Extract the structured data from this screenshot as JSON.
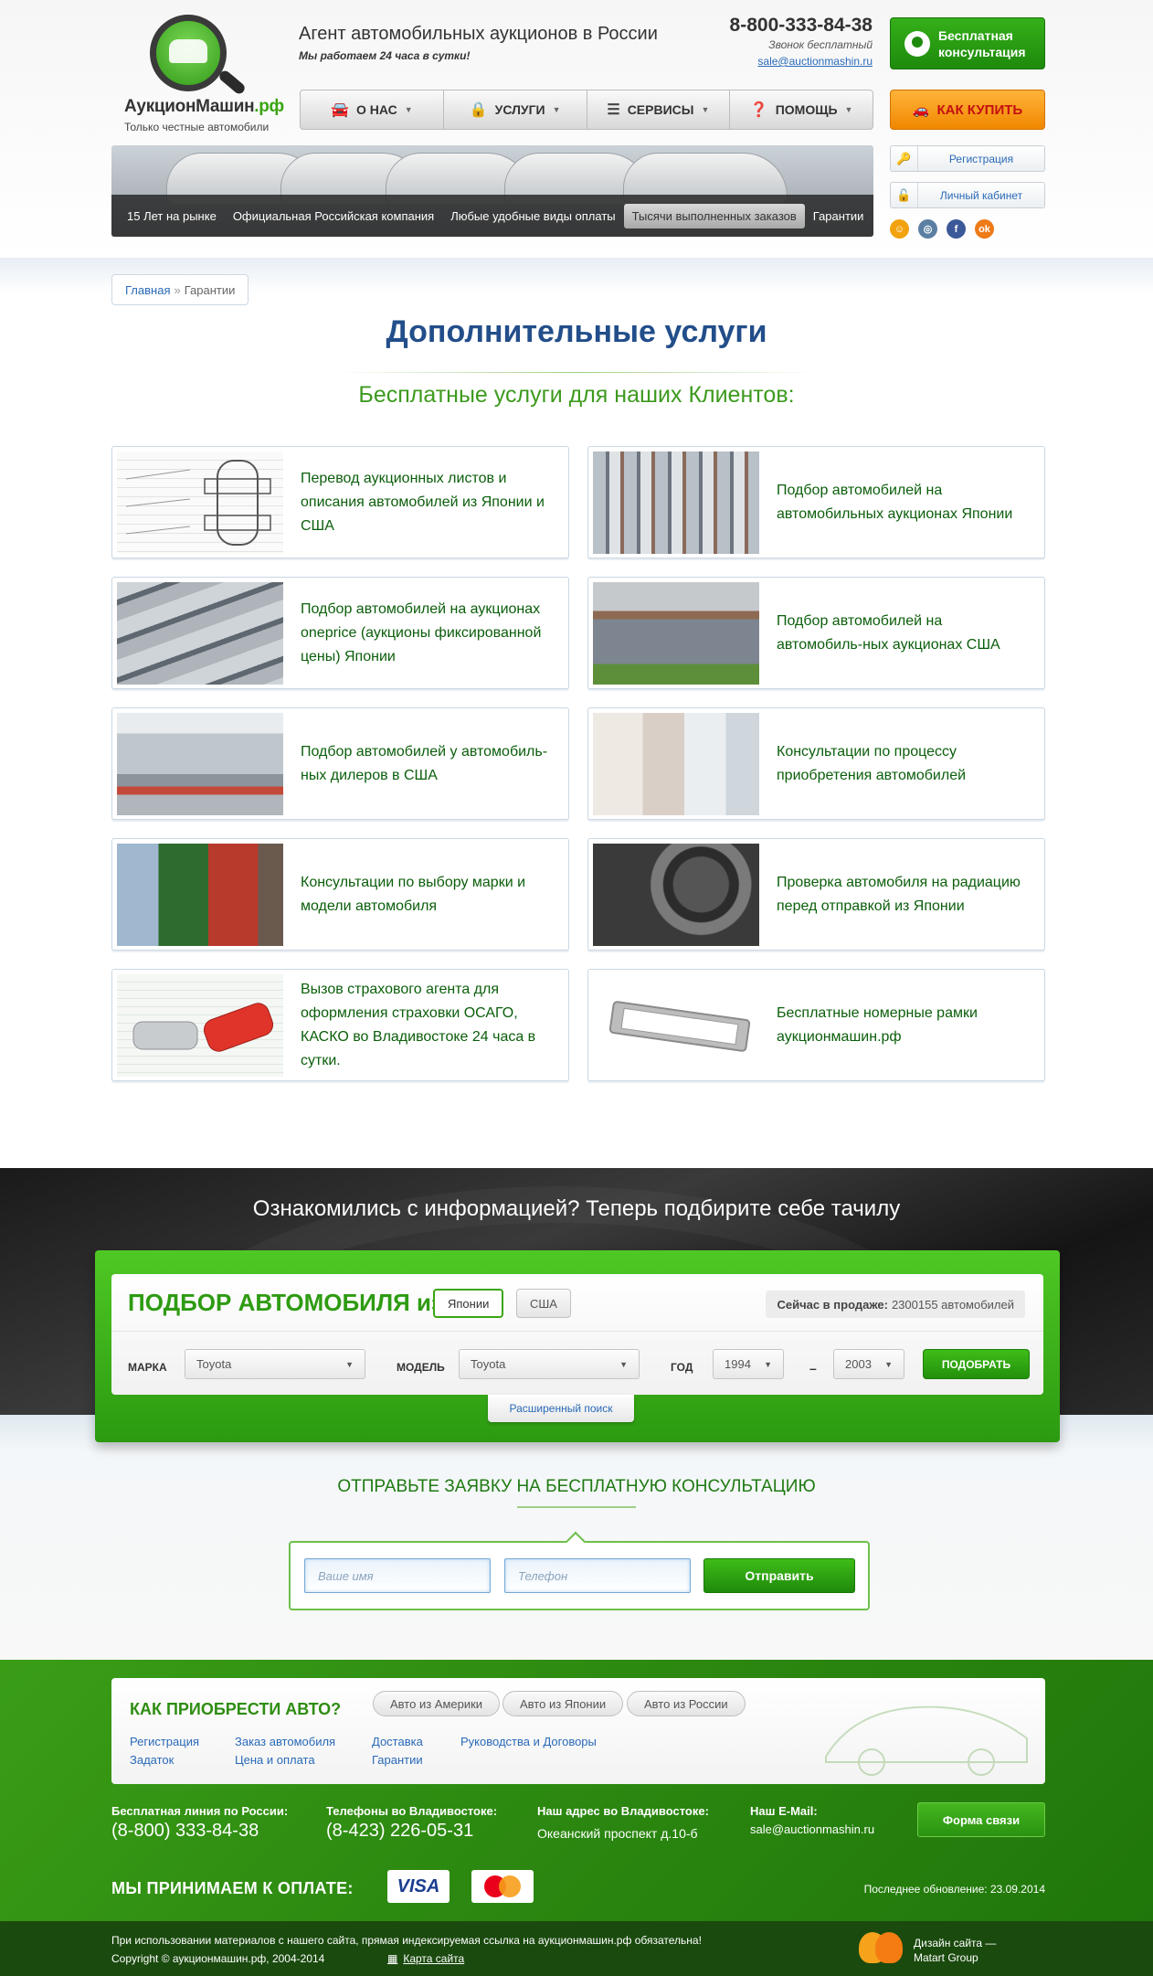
{
  "header": {
    "logo_name": "АукционМашин",
    "logo_rf": ".рф",
    "logo_tagline": "Только честные автомобили",
    "slogan": "Агент автомобильных аукционов в России",
    "slogan_sub": "Мы работаем 24 часа в сутки!",
    "phone": "8-800-333-84-38",
    "phone_note": "Звонок бесплатный",
    "email": "sale@auctionmashin.ru",
    "consult_button": "Бесплатная консультация",
    "howbuy_button": "КАК КУПИТЬ",
    "nav": [
      {
        "label": "О НАС",
        "icon": "car-icon"
      },
      {
        "label": "УСЛУГИ",
        "icon": "lock-icon"
      },
      {
        "label": "СЕРВИСЫ",
        "icon": "list-icon"
      },
      {
        "label": "ПОМОЩЬ",
        "icon": "help-icon"
      }
    ],
    "banner_tabs": [
      "15 Лет на рынке",
      "Официальная Российская компания",
      "Любые удобные виды оплаты",
      "Тысячи выполненных заказов",
      "Гарантии"
    ],
    "active_banner_tab": 3,
    "register": "Регистрация",
    "cabinet": "Личный кабинет",
    "socials": [
      {
        "name": "odnoklassniki-icon",
        "color": "#f2a20f"
      },
      {
        "name": "instagram-icon",
        "color": "#5b7fa3"
      },
      {
        "name": "facebook-icon",
        "color": "#3b5998"
      },
      {
        "name": "ok-icon",
        "color": "#ee7a18"
      }
    ]
  },
  "breadcrumb": {
    "home": "Главная",
    "sep": "»",
    "current": "Гарантии"
  },
  "page": {
    "title": "Дополнительные услуги",
    "subtitle": "Бесплатные услуги для наших Клиентов:"
  },
  "services": [
    {
      "text": "Перевод аукционных листов и описания автомобилей из Японии и США",
      "thumb": "auction-sheet"
    },
    {
      "text": "Подбор автомобилей на автомобильных аукционах Японии",
      "thumb": "car-lot"
    },
    {
      "text": "Подбор автомобилей на аукционах oneprice (аукционы фиксированной цены) Японии",
      "thumb": "car-lot-dark"
    },
    {
      "text": "Подбор автомобилей на автомобиль-ных аукционах США",
      "thumb": "usa-lot"
    },
    {
      "text": "Подбор автомобилей у автомобиль-ных дилеров в США",
      "thumb": "dealer"
    },
    {
      "text": "Консультации по процессу приобретения автомобилей",
      "thumb": "people"
    },
    {
      "text": "Консультации по выбору марки и модели автомобиля",
      "thumb": "consult"
    },
    {
      "text": "Проверка автомобиля на радиацию перед отправкой из Японии",
      "thumb": "interior"
    },
    {
      "text": "Вызов страхового агента для оформления страховки ОСАГО, КАСКО во Владивостоке 24 часа в сутки.",
      "thumb": "insurance"
    },
    {
      "text": "Бесплатные номерные рамки аукционмашин.рф",
      "thumb": "plate-frame"
    }
  ],
  "picker": {
    "banner_title": "Ознакомились с информацией? Теперь подбирите себе тачилу",
    "title": "ПОДБОР АВТОМОБИЛЯ из",
    "country_on": "Японии",
    "country_off": "США",
    "on_sale_label": "Сейчас в продаже:",
    "on_sale_value": "2300155 автомобилей",
    "make_label": "МАРКА",
    "make_value": "Toyota",
    "model_label": "МОДЕЛЬ",
    "model_value": "Toyota",
    "year_label": "ГОД",
    "year_from": "1994",
    "year_dash": "–",
    "year_to": "2003",
    "submit": "ПОДОБРАТЬ",
    "advanced": "Расширенный поиск"
  },
  "request": {
    "title": "ОТПРАВЬТЕ ЗАЯВКУ НА БЕСПЛАТНУЮ КОНСУЛЬТАЦИЮ",
    "name_placeholder": "Ваше имя",
    "phone_placeholder": "Телефон",
    "send": "Отправить"
  },
  "footer": {
    "howbuy_title": "КАК ПРИОБРЕСТИ АВТО?",
    "howbuy_pills": [
      "Авто из Америки",
      "Авто из Японии",
      "Авто из России"
    ],
    "links": [
      "Регистрация",
      "Заказ автомобиля",
      "Доставка",
      "Руководства и Договоры",
      "Задаток",
      "Цена и оплата",
      "Гарантии"
    ],
    "free_line_label": "Бесплатная линия по России:",
    "free_line": "(8-800) 333-84-38",
    "vl_phones_label": "Телефоны во Владивостоке:",
    "vl_phones": "(8-423) 226-05-31",
    "address_label": "Наш адрес во Владивостоке:",
    "address": "Океанский проспект д.10-б",
    "email_label": "Наш E-Mail:",
    "email": "sale@auctionmashin.ru",
    "form_button": "Форма связи",
    "pay_label": "МЫ ПРИНИМАЕМ К ОПЛАТЕ:",
    "visa": "VISA",
    "updated": "Последнее обновление: 23.09.2014",
    "legal": "При использовании материалов с нашего сайта, прямая индексируемая ссылка на аукционмашин.рф обязательна!",
    "copyright": "Copyright © аукционмашин.рф, 2004-2014",
    "sitemap": "Карта сайта",
    "design_line1": "Дизайн сайта —",
    "design_line2": "Matart Group"
  },
  "colors": {
    "brand_green": "#3aa512",
    "orange": "#f08700",
    "link_blue": "#2a6ab8",
    "title_blue": "#224e8a"
  }
}
